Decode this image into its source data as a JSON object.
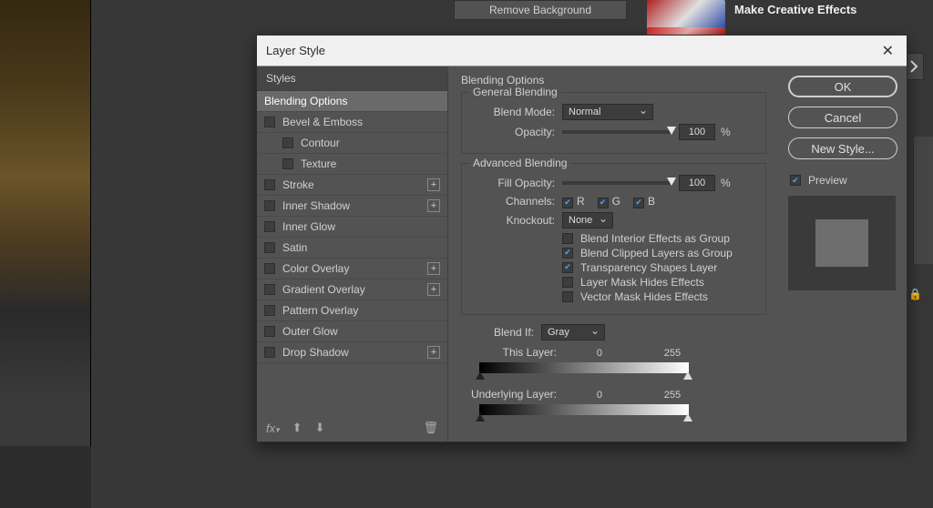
{
  "bg": {
    "remove_label": "Remove Background",
    "card_title": "Make Creative Effects"
  },
  "dialog": {
    "title": "Layer Style",
    "styles_header": "Styles",
    "items": [
      {
        "label": "Blending Options",
        "selected": true,
        "cb": false,
        "indent": 0,
        "plus": false
      },
      {
        "label": "Bevel & Emboss",
        "selected": false,
        "cb": true,
        "indent": 0,
        "plus": false
      },
      {
        "label": "Contour",
        "selected": false,
        "cb": true,
        "indent": 1,
        "plus": false
      },
      {
        "label": "Texture",
        "selected": false,
        "cb": true,
        "indent": 1,
        "plus": false
      },
      {
        "label": "Stroke",
        "selected": false,
        "cb": true,
        "indent": 0,
        "plus": true
      },
      {
        "label": "Inner Shadow",
        "selected": false,
        "cb": true,
        "indent": 0,
        "plus": true
      },
      {
        "label": "Inner Glow",
        "selected": false,
        "cb": true,
        "indent": 0,
        "plus": false
      },
      {
        "label": "Satin",
        "selected": false,
        "cb": true,
        "indent": 0,
        "plus": false
      },
      {
        "label": "Color Overlay",
        "selected": false,
        "cb": true,
        "indent": 0,
        "plus": true
      },
      {
        "label": "Gradient Overlay",
        "selected": false,
        "cb": true,
        "indent": 0,
        "plus": true
      },
      {
        "label": "Pattern Overlay",
        "selected": false,
        "cb": true,
        "indent": 0,
        "plus": false
      },
      {
        "label": "Outer Glow",
        "selected": false,
        "cb": true,
        "indent": 0,
        "plus": false
      },
      {
        "label": "Drop Shadow",
        "selected": false,
        "cb": true,
        "indent": 0,
        "plus": true
      }
    ],
    "opts_title": "Blending Options",
    "general_legend": "General Blending",
    "blend_mode_lbl": "Blend Mode:",
    "blend_mode_val": "Normal",
    "opacity_lbl": "Opacity:",
    "opacity_val": "100",
    "pct": "%",
    "advanced_legend": "Advanced Blending",
    "fill_opacity_lbl": "Fill Opacity:",
    "fill_opacity_val": "100",
    "channels_lbl": "Channels:",
    "chan_r": "R",
    "chan_g": "G",
    "chan_b": "B",
    "knockout_lbl": "Knockout:",
    "knockout_val": "None",
    "adv_flags": [
      {
        "label": "Blend Interior Effects as Group",
        "checked": false
      },
      {
        "label": "Blend Clipped Layers as Group",
        "checked": true
      },
      {
        "label": "Transparency Shapes Layer",
        "checked": true
      },
      {
        "label": "Layer Mask Hides Effects",
        "checked": false
      },
      {
        "label": "Vector Mask Hides Effects",
        "checked": false
      }
    ],
    "blendif_lbl": "Blend If:",
    "blendif_val": "Gray",
    "this_layer_lbl": "This Layer:",
    "this_layer_lo": "0",
    "this_layer_hi": "255",
    "under_layer_lbl": "Underlying Layer:",
    "under_layer_lo": "0",
    "under_layer_hi": "255",
    "ok": "OK",
    "cancel": "Cancel",
    "new_style": "New Style...",
    "preview": "Preview"
  }
}
